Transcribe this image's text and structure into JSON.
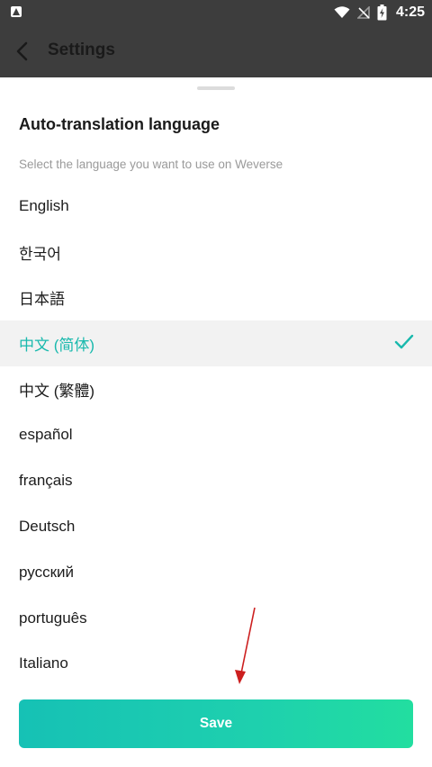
{
  "status_bar": {
    "time": "4:25"
  },
  "header": {
    "title": "Settings"
  },
  "sheet": {
    "title": "Auto-translation language",
    "subtitle": "Select the language you want to use on Weverse"
  },
  "languages": [
    {
      "label": "English"
    },
    {
      "label": "한국어"
    },
    {
      "label": "日本語"
    },
    {
      "label": "中文 (简体)",
      "selected": true
    },
    {
      "label": "中文 (繁體)"
    },
    {
      "label": "español"
    },
    {
      "label": "français"
    },
    {
      "label": "Deutsch"
    },
    {
      "label": "русский"
    },
    {
      "label": "português"
    },
    {
      "label": "Italiano"
    }
  ],
  "save_button": {
    "label": "Save"
  },
  "colors": {
    "accent": "#19b9ad",
    "header_bg": "#3d3d3d",
    "selected_row_bg": "#f2f2f2",
    "button_gradient_start": "#16c1b5",
    "button_gradient_end": "#22dea0",
    "annotation_arrow": "#cc1f1f"
  }
}
